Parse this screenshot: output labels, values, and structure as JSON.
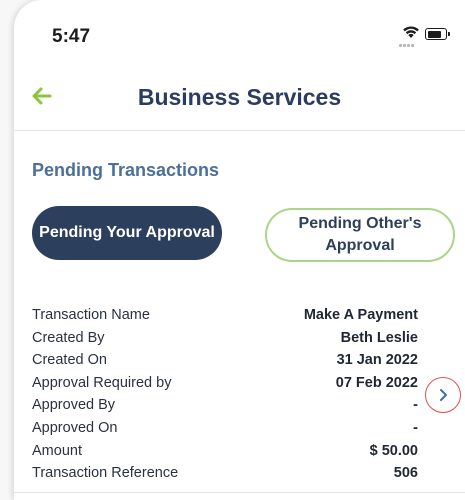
{
  "status_bar": {
    "time": "5:47"
  },
  "nav": {
    "title": "Business Services"
  },
  "section": {
    "title": "Pending Transactions"
  },
  "segments": {
    "active_label": "Pending Your Approval",
    "inactive_label": "Pending Other's Approval"
  },
  "transaction": {
    "rows": [
      {
        "label": "Transaction Name",
        "value": "Make A Payment"
      },
      {
        "label": "Created By",
        "value": "Beth Leslie"
      },
      {
        "label": "Created On",
        "value": "31 Jan 2022"
      },
      {
        "label": "Approval Required by",
        "value": "07 Feb 2022"
      },
      {
        "label": "Approved By",
        "value": "-"
      },
      {
        "label": "Approved On",
        "value": "-"
      },
      {
        "label": "Amount",
        "value": "$ 50.00"
      },
      {
        "label": "Transaction Reference",
        "value": "506"
      }
    ]
  },
  "colors": {
    "accent_green": "#8cc63f",
    "navy": "#2c3f5d",
    "section_blue": "#4d6f9b",
    "highlight_red": "#d9534f"
  },
  "icons": {
    "back": "arrow-left-icon",
    "next": "chevron-right-icon",
    "wifi": "wifi-icon",
    "battery": "battery-icon",
    "signal": "signal-dots-icon"
  }
}
